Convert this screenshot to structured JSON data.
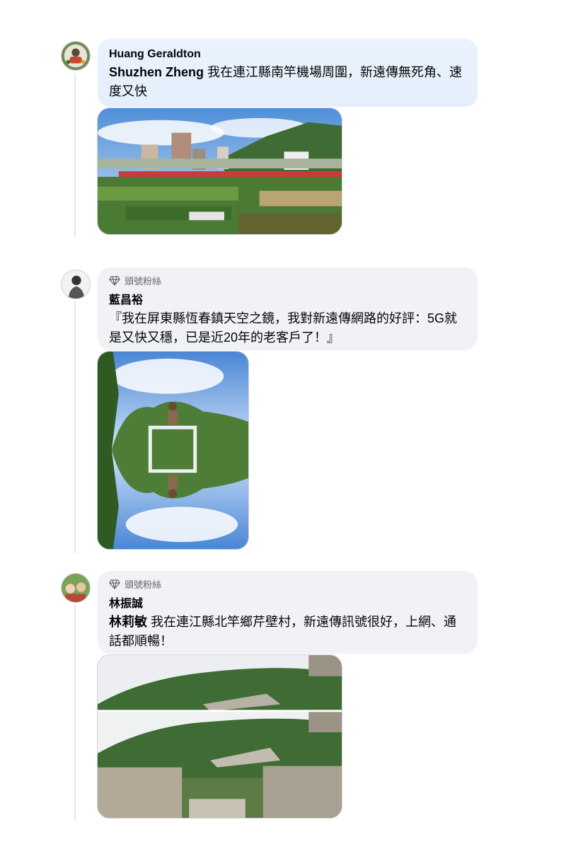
{
  "comments": [
    {
      "author": "Huang Geraldton",
      "mention": "Shuzhen Zheng",
      "text": "我在連江縣南竿機場周圍，新遠傳無死角、速度又快",
      "photo": "village-fields-photo"
    },
    {
      "badge": "頭號粉絲",
      "author": "藍昌裕",
      "text": "『我在屏東縣恆春鎮天空之鏡，我對新遠傳網路的好評：5G就是又快又穩，已是近20年的老客戶了！』",
      "photo": "sky-mirror-photo"
    },
    {
      "badge": "頭號粉絲",
      "author": "林振誠",
      "mention": "林莉敏",
      "text": "我在連江縣北竿鄉芹壁村，新遠傳訊號很好，上網、通話都順暢！",
      "photo": "hillside-village-photo"
    }
  ],
  "colors": {
    "bubble": "#f0f2f5",
    "bubble_highlight": "#e7f0fb",
    "secondary_text": "#65676b"
  }
}
